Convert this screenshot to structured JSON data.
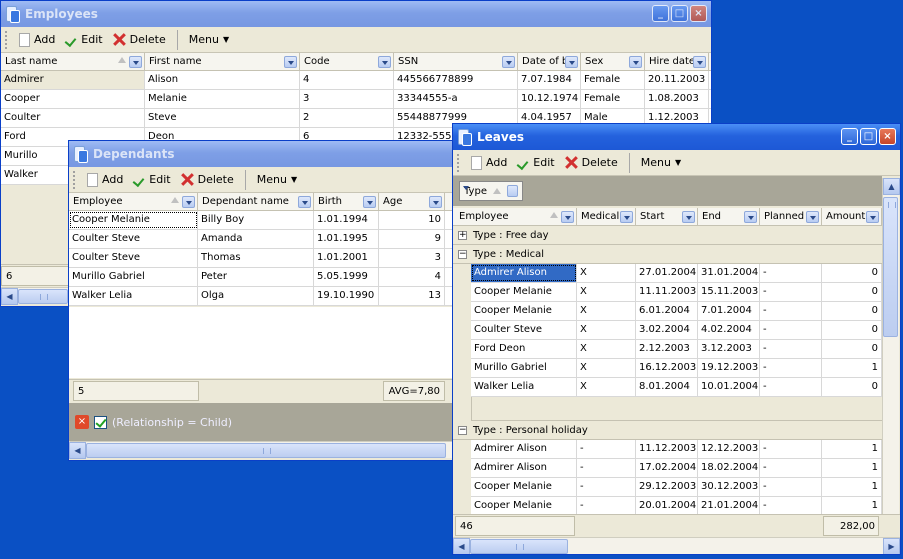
{
  "employees": {
    "title": "Employees",
    "toolbar": {
      "add": "Add",
      "edit": "Edit",
      "delete": "Delete",
      "menu": "Menu"
    },
    "columns": [
      "Last name",
      "First name",
      "Code",
      "SSN",
      "Date of b",
      "Sex",
      "Hire date"
    ],
    "rows": [
      [
        "Admirer",
        "Alison",
        "4",
        "445566778899",
        "7.07.1984",
        "Female",
        "20.11.2003"
      ],
      [
        "Cooper",
        "Melanie",
        "3",
        "33344555-a",
        "10.12.1974",
        "Female",
        "1.08.2003"
      ],
      [
        "Coulter",
        "Steve",
        "2",
        "55448877999",
        "4.04.1957",
        "Male",
        "1.12.2003"
      ],
      [
        "Ford",
        "Deon",
        "6",
        "12332-5555",
        "",
        "",
        ""
      ],
      [
        "Murillo",
        "",
        "",
        "",
        "",
        "",
        ""
      ],
      [
        "Walker",
        "",
        "",
        "",
        "",
        "",
        ""
      ]
    ],
    "footer_count": "6"
  },
  "dependants": {
    "title": "Dependants",
    "toolbar": {
      "add": "Add",
      "edit": "Edit",
      "delete": "Delete",
      "menu": "Menu"
    },
    "columns": [
      "Employee",
      "Dependant name",
      "Birth",
      "Age",
      ""
    ],
    "rows": [
      [
        "Cooper Melanie",
        "Billy Boy",
        "1.01.1994",
        "10",
        ""
      ],
      [
        "Coulter Steve",
        "Amanda",
        "1.01.1995",
        "9",
        ""
      ],
      [
        "Coulter Steve",
        "Thomas",
        "1.01.2001",
        "3",
        ""
      ],
      [
        "Murillo Gabriel",
        "Peter",
        "5.05.1999",
        "4",
        ""
      ],
      [
        "Walker Lelia",
        "Olga",
        "19.10.1990",
        "13",
        ""
      ]
    ],
    "footer_count": "5",
    "footer_avg": "AVG=7,80",
    "filter_text": "(Relationship = Child)"
  },
  "leaves": {
    "title": "Leaves",
    "toolbar": {
      "add": "Add",
      "edit": "Edit",
      "delete": "Delete",
      "menu": "Menu"
    },
    "group_by": "Type",
    "columns": [
      "Employee",
      "Medical",
      "Start",
      "End",
      "Planned",
      "Amount"
    ],
    "groups": [
      {
        "label": "Type : Free day",
        "expanded": false,
        "rows": []
      },
      {
        "label": "Type : Medical",
        "expanded": true,
        "rows": [
          [
            "Admirer Alison",
            "X",
            "27.01.2004",
            "31.01.2004",
            "-",
            "0"
          ],
          [
            "Cooper Melanie",
            "X",
            "11.11.2003",
            "15.11.2003",
            "-",
            "0"
          ],
          [
            "Cooper Melanie",
            "X",
            "6.01.2004",
            "7.01.2004",
            "-",
            "0"
          ],
          [
            "Coulter Steve",
            "X",
            "3.02.2004",
            "4.02.2004",
            "-",
            "0"
          ],
          [
            "Ford Deon",
            "X",
            "2.12.2003",
            "3.12.2003",
            "-",
            "0"
          ],
          [
            "Murillo Gabriel",
            "X",
            "16.12.2003",
            "19.12.2003",
            "-",
            "1"
          ],
          [
            "Walker Lelia",
            "X",
            "8.01.2004",
            "10.01.2004",
            "-",
            "0"
          ]
        ]
      },
      {
        "label": "Type : Personal holiday",
        "expanded": true,
        "rows": [
          [
            "Admirer Alison",
            "-",
            "11.12.2003",
            "12.12.2003",
            "-",
            "1"
          ],
          [
            "Admirer Alison",
            "-",
            "17.02.2004",
            "18.02.2004",
            "-",
            "1"
          ],
          [
            "Cooper Melanie",
            "-",
            "29.12.2003",
            "30.12.2003",
            "-",
            "1"
          ],
          [
            "Cooper Melanie",
            "-",
            "20.01.2004",
            "21.01.2004",
            "-",
            "1"
          ]
        ]
      }
    ],
    "footer_count": "46",
    "footer_sum": "282,00"
  }
}
